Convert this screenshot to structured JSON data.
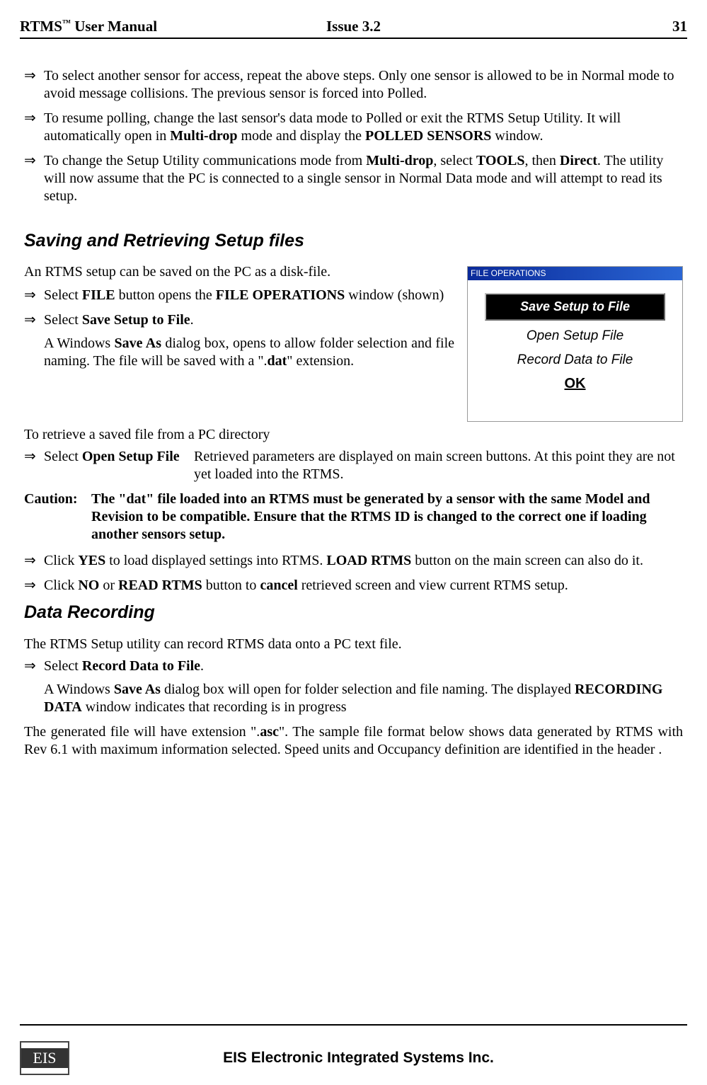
{
  "header": {
    "left_pre": "RTMS",
    "tm": "™",
    "left_post": " User Manual",
    "center": "Issue 3.2",
    "right": "31"
  },
  "top_bullets": {
    "arrow": "⇒",
    "b1": "To select another sensor for access, repeat the above steps. Only one sensor is allowed to be in Normal mode to avoid message collisions. The previous sensor is forced into Polled.",
    "b2_pre": "To resume polling, change the last sensor's data mode to Polled or exit the RTMS Setup Utility. It will automatically open in ",
    "b2_bold1": "Multi-drop",
    "b2_mid": " mode and display the ",
    "b2_bold2": "POLLED SENSORS",
    "b2_post": " window.",
    "b3_pre": "To change the Setup Utility communications mode from ",
    "b3_bold1": "Multi-drop",
    "b3_mid1": ",  select ",
    "b3_bold2": "TOOLS",
    "b3_mid2": ", then ",
    "b3_bold3": "Direct",
    "b3_post": ". The utility will now assume that the PC is connected to a single sensor in Normal Data mode and will attempt to read its setup."
  },
  "sec_save": {
    "heading": "Saving and Retrieving Setup files",
    "intro": "An RTMS setup can be saved on the PC as a disk-file.",
    "s1_pre": "Select  ",
    "s1_bold1": "FILE",
    "s1_mid": " button opens the ",
    "s1_bold2": "FILE OPERATIONS",
    "s1_post": " window (shown)",
    "s2_pre": "Select ",
    "s2_bold": "Save Setup to File",
    "s2_post": ".",
    "s2_sub_pre": "A Windows ",
    "s2_sub_bold1": "Save As",
    "s2_sub_mid": " dialog box, opens to allow folder selection and file naming. The file will be saved with a \".",
    "s2_sub_bold2": "dat",
    "s2_sub_post": "\" extension.",
    "retrieve_intro": "To retrieve a saved file from a PC directory",
    "r_col1_pre": "Select ",
    "r_col1_bold": "Open Setup File",
    "r_col2": "Retrieved parameters  are displayed on main screen buttons.  At this point they are not yet loaded into the RTMS.",
    "caution_label": "Caution:",
    "caution_text": "The \"dat\" file loaded into an RTMS must be generated by a sensor with the same Model and Revision to be compatible. Ensure that the RTMS ID is changed to the correct one  if loading another sensors setup.",
    "y_pre": "Click ",
    "y_bold1": "YES",
    "y_mid": " to load displayed settings into RTMS.  ",
    "y_bold2": "LOAD RTMS",
    "y_post": " button on the main screen can also do it.",
    "n_pre": "Click ",
    "n_bold1": "NO",
    "n_mid": " or  ",
    "n_bold2": "READ RTMS",
    "n_mid2": " button to ",
    "n_bold3": "cancel",
    "n_post": " retrieved screen and view current RTMS setup."
  },
  "fig": {
    "title": "FILE OPERATIONS",
    "btn": "Save Setup to File",
    "opt1": "Open Setup File",
    "opt2": "Record Data to File",
    "ok": "OK"
  },
  "sec_rec": {
    "heading": "Data Recording",
    "intro": "The RTMS Setup utility can record RTMS data onto a PC text file.",
    "r1_pre": "Select ",
    "r1_bold": "Record Data to File",
    "r1_post": ".",
    "r1_sub_pre": "A Windows ",
    "r1_sub_bold1": "Save As",
    "r1_sub_mid": " dialog box will open for folder selection and file naming. The displayed ",
    "r1_sub_bold2": "RECORDING DATA",
    "r1_sub_post": " window indicates that recording is in progress",
    "gen_pre": "The generated file will have extension \".",
    "gen_bold": "asc",
    "gen_post": "\". The sample file format below shows data generated by RTMS with Rev 6.1 with maximum information selected.  Speed units and Occupancy definition are identified in the header ."
  },
  "footer": {
    "logo": "EIS",
    "text": "EIS Electronic Integrated Systems Inc."
  }
}
